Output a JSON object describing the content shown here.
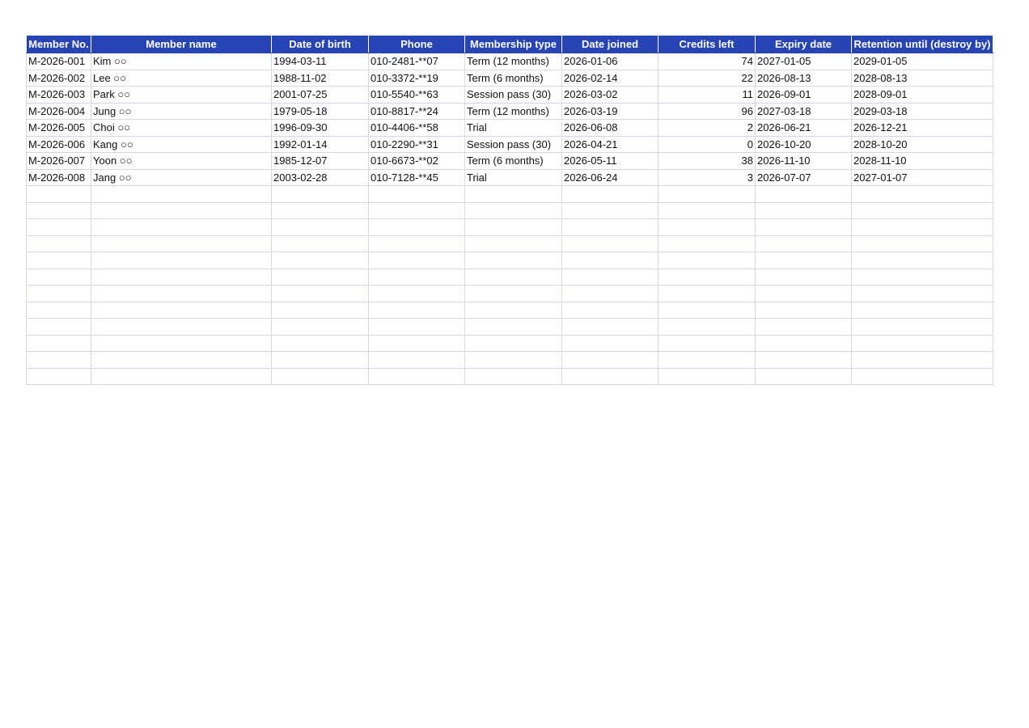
{
  "sheet": {
    "headers": [
      "Member No.",
      "Member name",
      "Date of birth",
      "Phone",
      "Membership type",
      "Date joined",
      "Credits left",
      "Expiry date",
      "Retention until (destroy by)"
    ],
    "rows": [
      [
        "M-2026-001",
        "Kim ○○",
        "1994-03-11",
        "010-2481-**07",
        "Term (12 months)",
        "2026-01-06",
        "74",
        "2027-01-05",
        "2029-01-05"
      ],
      [
        "M-2026-002",
        "Lee ○○",
        "1988-11-02",
        "010-3372-**19",
        "Term (6 months)",
        "2026-02-14",
        "22",
        "2026-08-13",
        "2028-08-13"
      ],
      [
        "M-2026-003",
        "Park ○○",
        "2001-07-25",
        "010-5540-**63",
        "Session pass (30)",
        "2026-03-02",
        "11",
        "2026-09-01",
        "2028-09-01"
      ],
      [
        "M-2026-004",
        "Jung ○○",
        "1979-05-18",
        "010-8817-**24",
        "Term (12 months)",
        "2026-03-19",
        "96",
        "2027-03-18",
        "2029-03-18"
      ],
      [
        "M-2026-005",
        "Choi ○○",
        "1996-09-30",
        "010-4406-**58",
        "Trial",
        "2026-06-08",
        "2",
        "2026-06-21",
        "2026-12-21"
      ],
      [
        "M-2026-006",
        "Kang ○○",
        "1992-01-14",
        "010-2290-**31",
        "Session pass (30)",
        "2026-04-21",
        "0",
        "2026-10-20",
        "2028-10-20"
      ],
      [
        "M-2026-007",
        "Yoon ○○",
        "1985-12-07",
        "010-6673-**02",
        "Term (6 months)",
        "2026-05-11",
        "38",
        "2026-11-10",
        "2028-11-10"
      ],
      [
        "M-2026-008",
        "Jang ○○",
        "2003-02-28",
        "010-7128-**45",
        "Trial",
        "2026-06-24",
        "3",
        "2026-07-07",
        "2027-01-07"
      ]
    ]
  }
}
